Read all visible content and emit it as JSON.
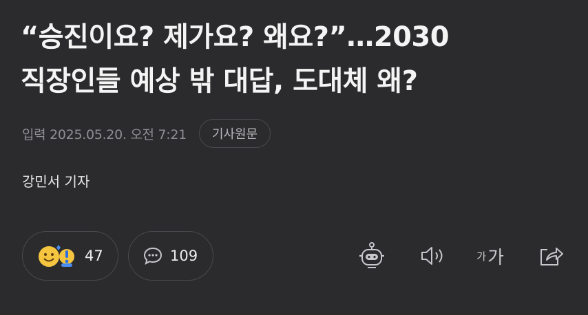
{
  "article": {
    "headline_line1": "“승진이요? 제가요? 왜요?”…2030",
    "headline_line2": "직장인들 예상 밖 대답, 도대체 왜?",
    "date": "입력 2025.05.20. 오전 7:21",
    "source_button": "기사원문",
    "reporter": "강민서 기자"
  },
  "actions": {
    "reactions_count": "47",
    "comments_count": "109",
    "font_size_small": "가",
    "font_size_large": "가"
  },
  "icons": {
    "reaction": "emoji-reaction-icon",
    "comment": "speech-bubble-icon",
    "summary": "robot-icon",
    "audio": "speaker-icon",
    "share": "share-icon"
  },
  "colors": {
    "background": "#2b2b2d",
    "text": "#f4f4f4",
    "muted": "#8e8e93",
    "border": "#4a4a4e"
  }
}
